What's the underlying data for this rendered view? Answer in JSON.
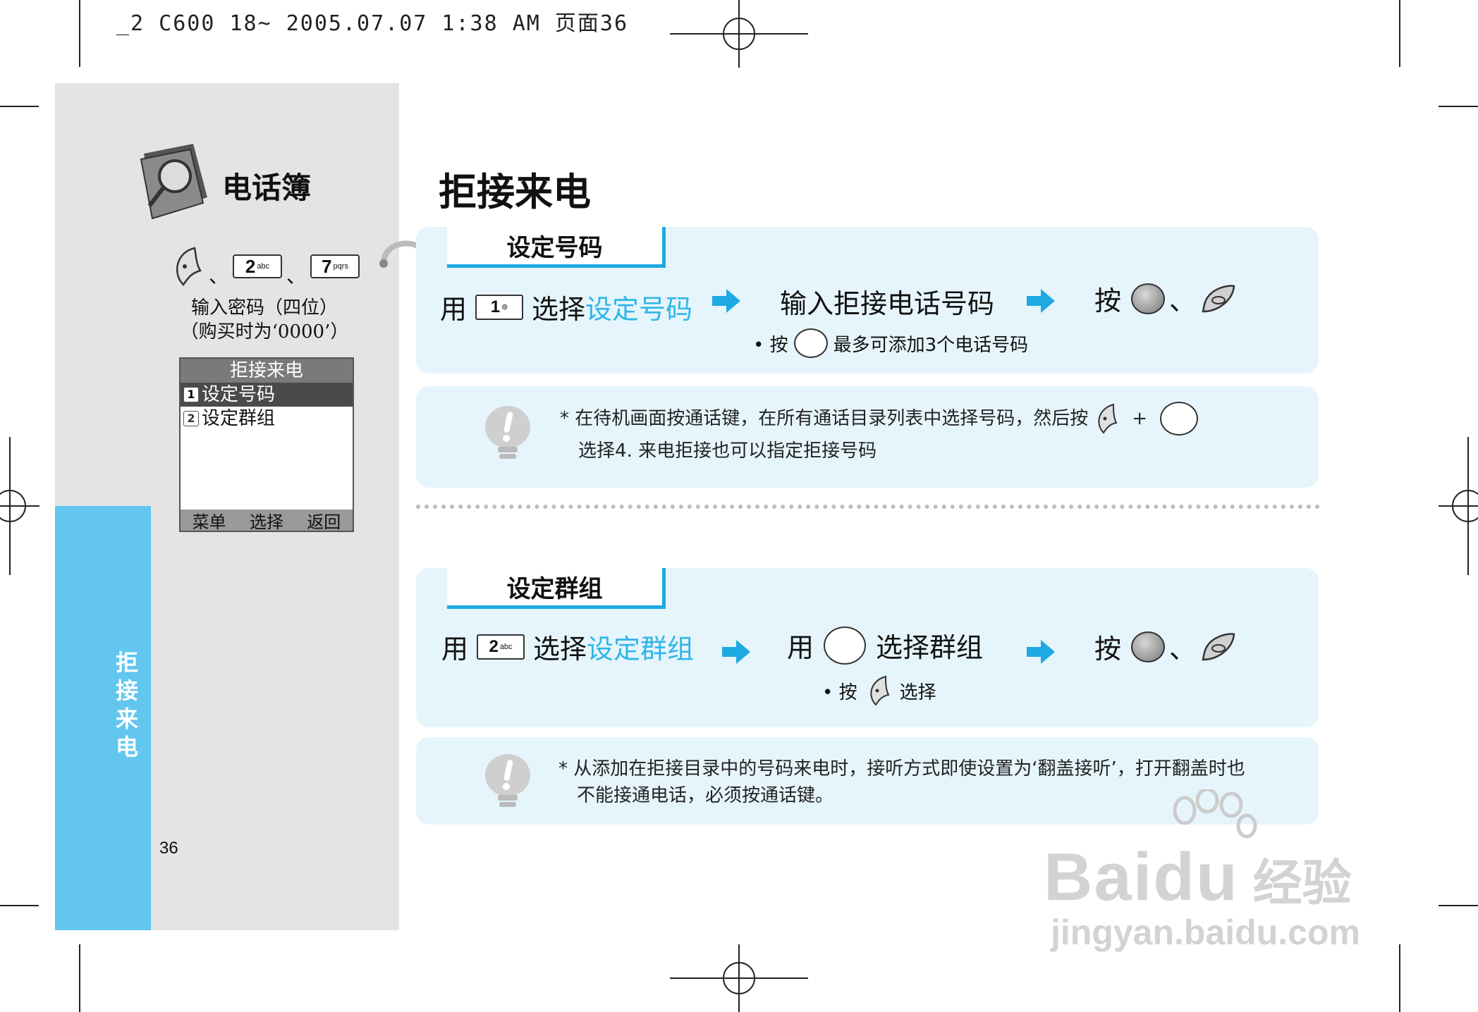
{
  "print_header": "_2 C600 18~ 2005.07.07 1:38 AM 页面36",
  "sidebar": {
    "title": "电话簿",
    "key_separator": "、",
    "key2": {
      "num": "2",
      "letters": "abc"
    },
    "key7": {
      "num": "7",
      "letters": "pqrs"
    },
    "note_line1": "输入密码（四位）",
    "note_line2": "（购买时为‘0000’）",
    "vertical_label": [
      "拒",
      "接",
      "来",
      "电"
    ],
    "page_number": "36"
  },
  "phone_screen": {
    "header": "拒接来电",
    "items": [
      {
        "num": "1",
        "label": "设定号码"
      },
      {
        "num": "2",
        "label": "设定群组"
      }
    ],
    "softkeys": [
      "菜单",
      "选择",
      "返回"
    ]
  },
  "main": {
    "title": "拒接来电",
    "section1": {
      "tab": "设定号码",
      "step1_prefix": "用",
      "step1_key": "1",
      "step1_mid": "选择",
      "step1_highlight": "设定号码",
      "step2": "输入拒接电话号码",
      "step3_prefix": "按",
      "step3_sep": "、",
      "note_prefix": "• 按",
      "note_suffix": "最多可添加3个电话号码",
      "tip_line1_start": "* 在待机画面按通话键，在所有通话目录列表中选择号码，然后按",
      "tip_plus": "+",
      "tip_line2": "选择4. 来电拒接也可以指定拒接号码"
    },
    "section2": {
      "tab": "设定群组",
      "step1_prefix": "用",
      "step1_key": "2",
      "step1_key_letters": "abc",
      "step1_mid": "选择",
      "step1_highlight": "设定群组",
      "step2_prefix": "用",
      "step2_suffix": "选择群组",
      "step3_prefix": "按",
      "step3_sep": "、",
      "note_prefix": "• 按",
      "note_suffix": "选择",
      "tip_line1": "* 从添加在拒接目录中的号码来电时，接听方式即使设置为‘翻盖接听’，打开翻盖时也",
      "tip_line2": "不能接通电话，必须按通话键。"
    }
  },
  "watermark": {
    "brand": "Baidu",
    "cn": "经验",
    "url": "jingyan.baidu.com"
  },
  "colors": {
    "accent_blue": "#1ea9e2",
    "highlight_text": "#30b6e8",
    "panel_bg": "#e6f5fc",
    "sidebar_blue": "#62c6ee"
  }
}
